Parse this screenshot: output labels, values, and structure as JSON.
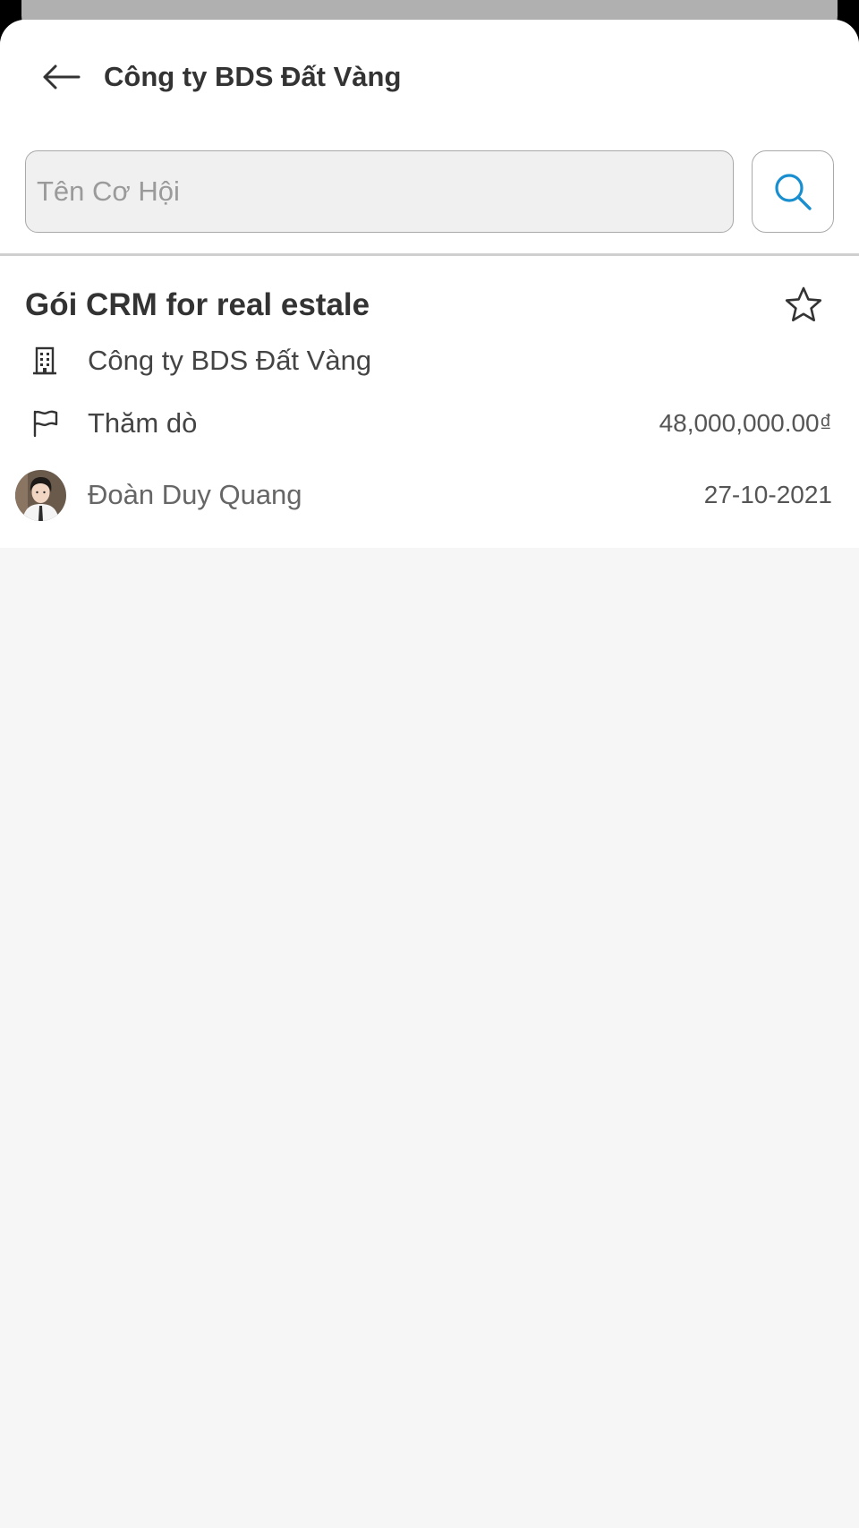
{
  "header": {
    "title": "Công ty BDS Đất Vàng",
    "back_icon": "arrow-left-icon"
  },
  "search": {
    "placeholder": "Tên Cơ Hội",
    "value": "",
    "button_icon": "search-icon",
    "accent_color": "#1a8fd0"
  },
  "opportunity": {
    "title": "Gói CRM for real estale",
    "favorite_icon": "star-outline-icon",
    "company_icon": "building-icon",
    "company": "Công ty BDS Đất Vàng",
    "stage_icon": "flag-icon",
    "stage": "Thăm dò",
    "amount": "48,000,000.00₫",
    "owner_avatar": "avatar",
    "owner": "Đoàn Duy Quang",
    "date": "27-10-2021"
  }
}
